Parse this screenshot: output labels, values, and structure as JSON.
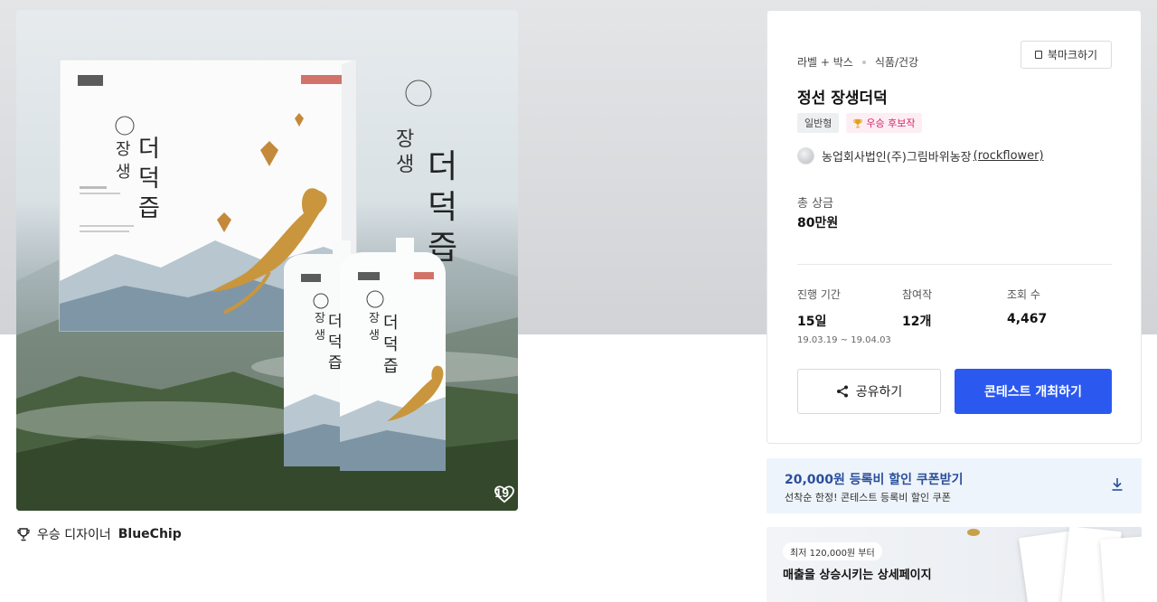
{
  "product_image": {
    "like_count": "19"
  },
  "designer": {
    "prefix": "우승 디자이너",
    "name": "BlueChip"
  },
  "panel": {
    "category": "라벨 + 박스",
    "subcategory": "식품/건강",
    "bookmark_label": "북마크하기",
    "title": "정선 장생더덕",
    "badges": {
      "type": "일반형",
      "winner": "우승 후보작"
    },
    "owner": {
      "name": "농업회사법인(주)그림바위농장",
      "handle": "(rockflower)"
    },
    "prize": {
      "label": "총 상금",
      "value": "80만원"
    },
    "stats": {
      "period": {
        "label": "진행 기간",
        "value": "15일",
        "range": "19.03.19 ~ 19.04.03"
      },
      "entries": {
        "label": "참여작",
        "value": "12개"
      },
      "views": {
        "label": "조회 수",
        "value": "4,467"
      }
    },
    "share_label": "공유하기",
    "host_label": "콘테스트 개최하기"
  },
  "coupon": {
    "title": "20,000원 등록비 할인 쿠폰받기",
    "subtitle": "선착순 한정! 콘테스트 등록비 할인 쿠폰"
  },
  "promo": {
    "pill": "최저 120,000원 부터",
    "title": "매출을 상승시키는 상세페이지"
  },
  "colors": {
    "primary_button": "#2b59f0",
    "coupon_text": "#2a4f9c",
    "winner_badge": "#d4276b"
  }
}
